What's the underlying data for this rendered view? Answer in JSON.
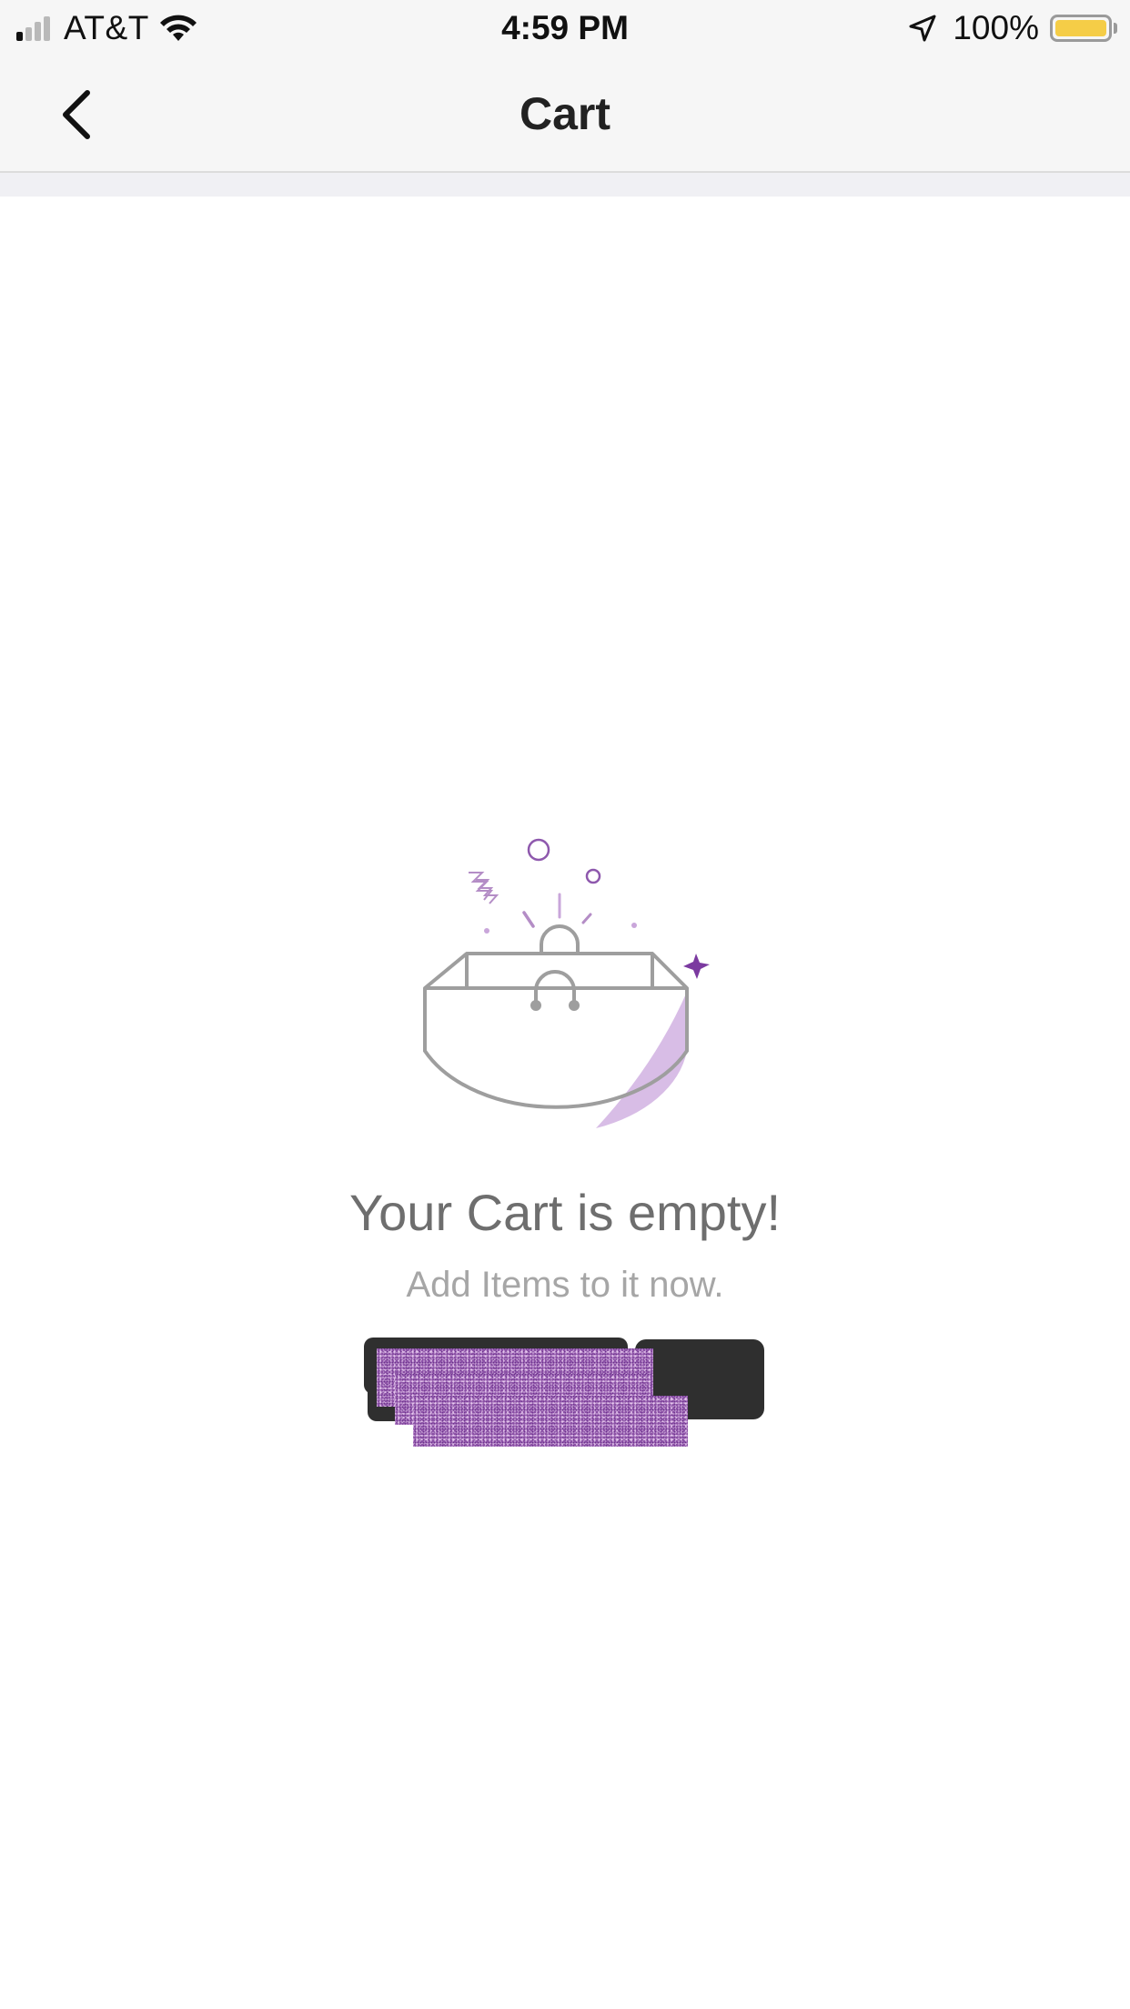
{
  "status_bar": {
    "carrier": "AT&T",
    "time": "4:59 PM",
    "battery_percent": "100%",
    "signal_bars_active": 1,
    "signal_bars_total": 4,
    "battery_level": 1.0,
    "battery_color": "#f5cd47",
    "icons": [
      "signal-icon",
      "wifi-icon",
      "location-arrow-icon",
      "battery-icon"
    ]
  },
  "nav": {
    "title": "Cart",
    "back_icon": "chevron-left-icon"
  },
  "empty_state": {
    "illustration_icon": "shopping-bag-icon",
    "title": "Your Cart is empty!",
    "subtitle": "Add Items to it now."
  },
  "cta": {
    "label": ""
  },
  "colors": {
    "accent_purple": "#7b3aa0",
    "light_purple": "#d8bde6",
    "bag_gray": "#9e9e9e",
    "button_dark": "#2f2f2f"
  }
}
